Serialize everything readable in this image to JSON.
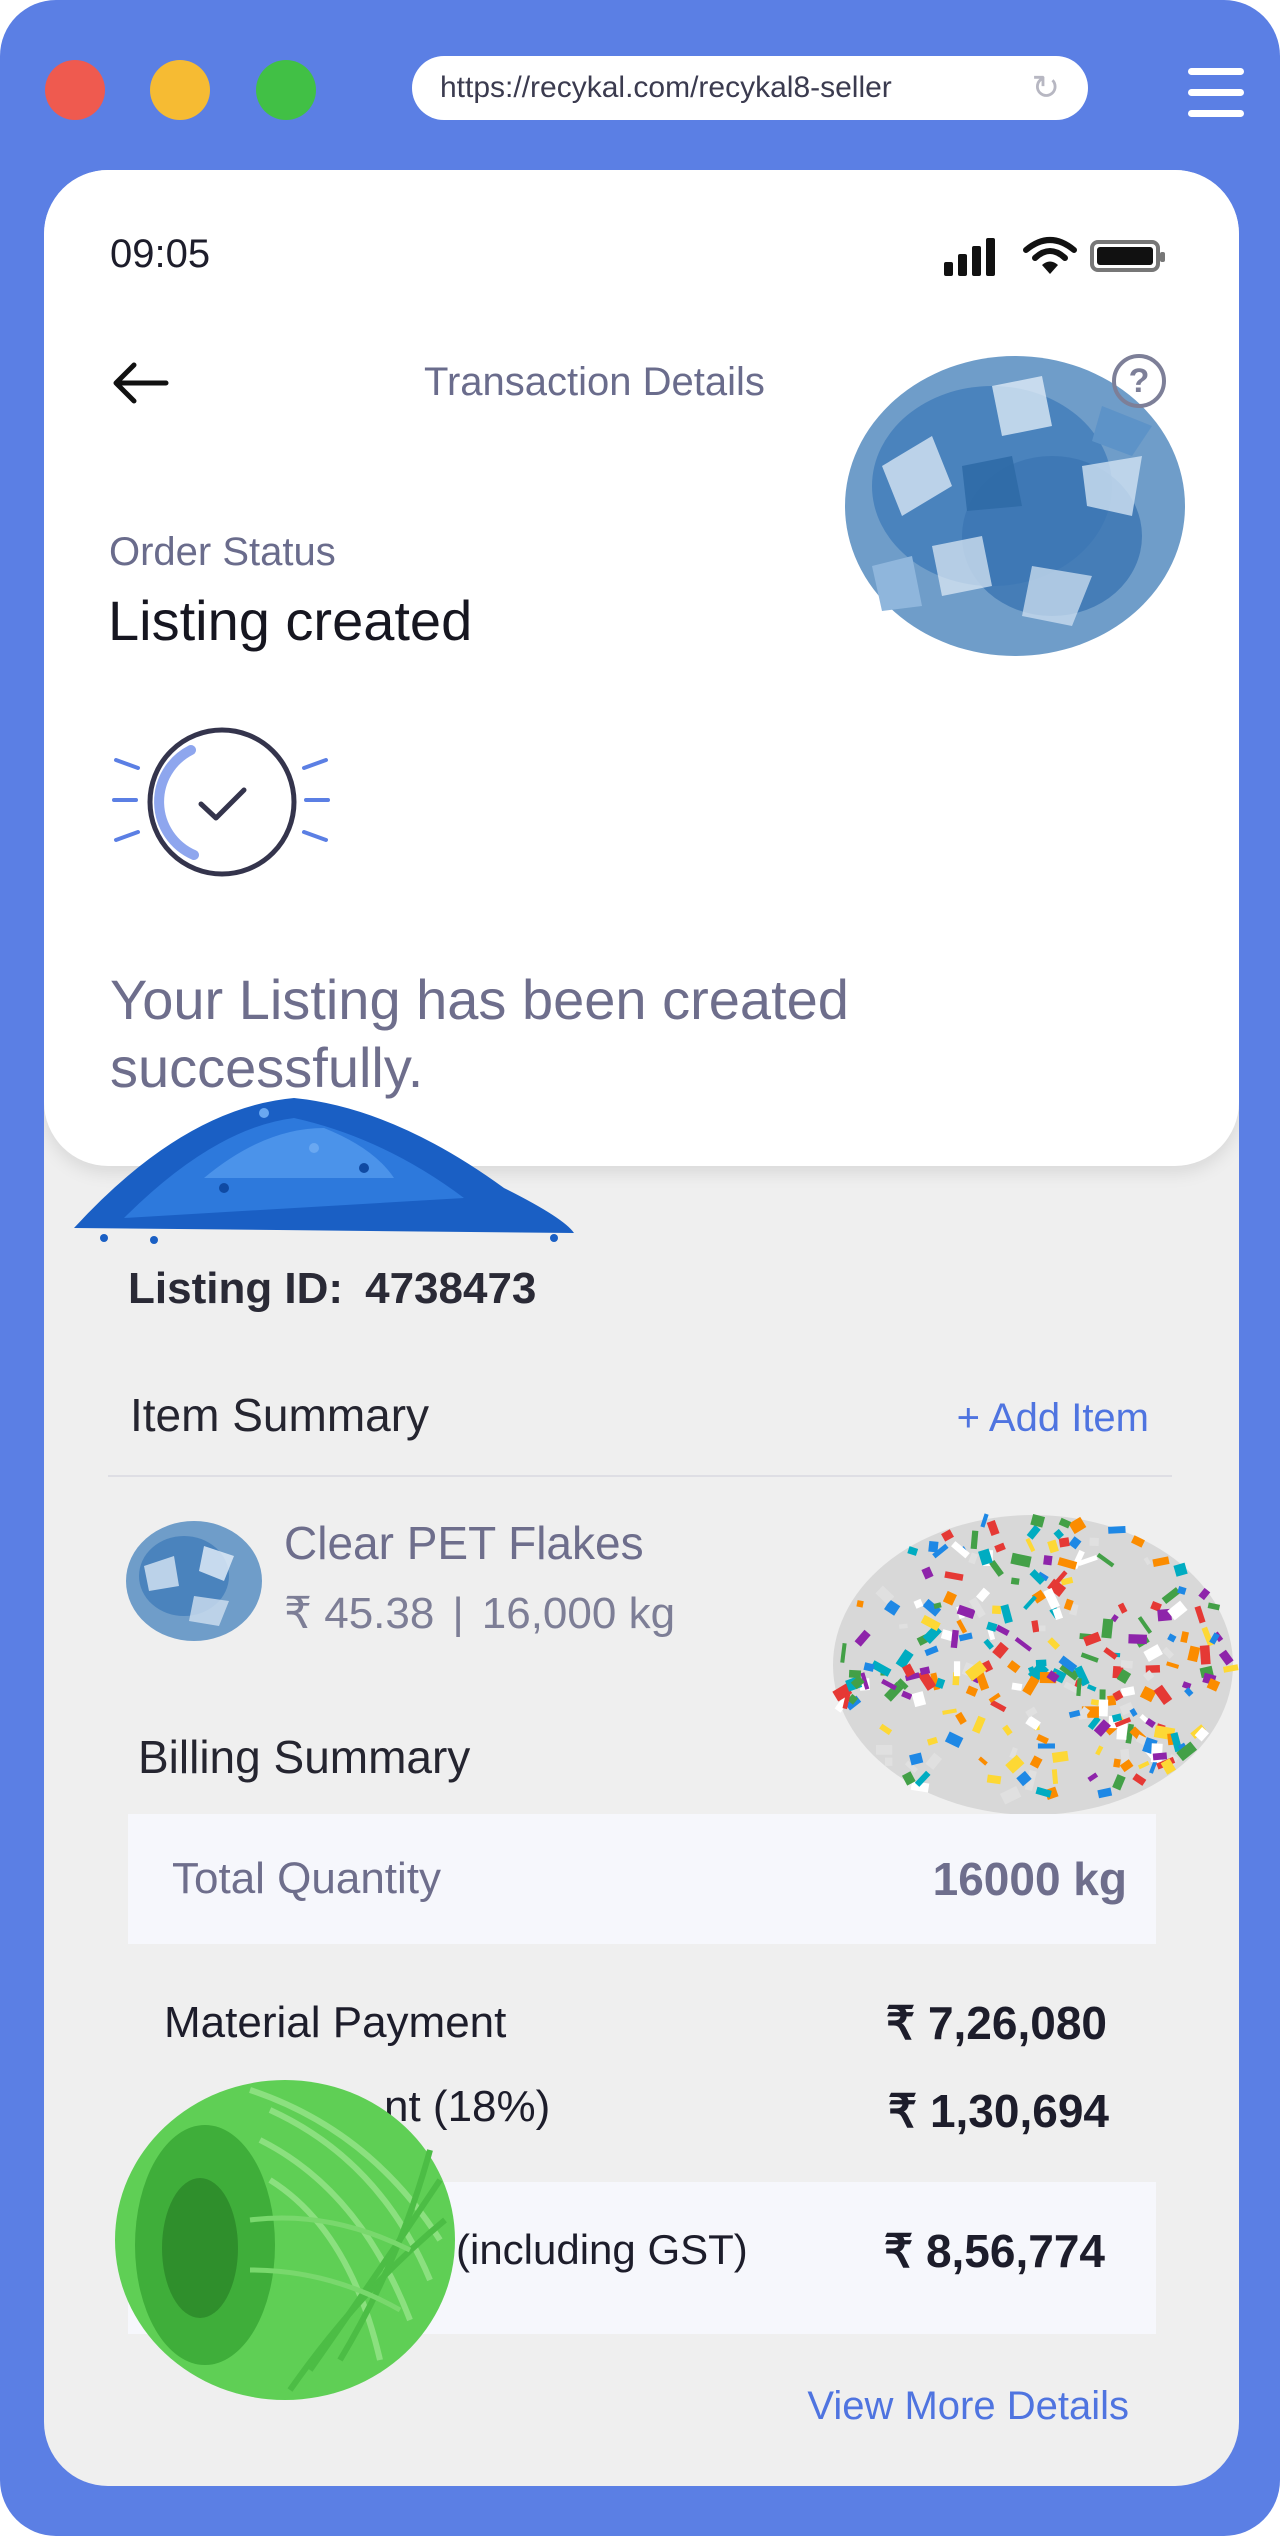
{
  "browser": {
    "url": "https://recykal.com/recykal8-seller",
    "reload_icon": "reload-icon",
    "menu_icon": "hamburger-menu-icon"
  },
  "status_bar": {
    "time": "09:05",
    "icons": [
      "signal-icon",
      "wifi-icon",
      "battery-icon"
    ]
  },
  "header": {
    "title": "Transaction Details",
    "back_icon": "back-arrow-icon",
    "help_icon": "help-icon",
    "help_glyph": "?"
  },
  "order": {
    "status_label": "Order Status",
    "status_value": "Listing created",
    "success_message": "Your Listing has been created successfully."
  },
  "listing": {
    "label": "Listing ID:",
    "id": "4738473"
  },
  "item_summary": {
    "title": "Item Summary",
    "add_label": "+ Add Item",
    "items": [
      {
        "name": "Clear PET Flakes",
        "price": "₹ 45.38",
        "separator": "|",
        "quantity": "16,000 kg"
      }
    ]
  },
  "billing": {
    "title": "Billing Summary",
    "total_quantity_label": "Total Quantity",
    "total_quantity_value": "16000 kg",
    "material_payment_label": "Material Payment",
    "material_payment_value": "₹ 7,26,080",
    "gst_label_visible": "nt (18%)",
    "gst_value": "₹ 1,30,694",
    "total_label_visible": "(including GST)",
    "total_value": "₹ 8,56,774"
  },
  "view_more_label": "View More Details",
  "colors": {
    "frame": "#5b7fe4",
    "accent": "#4f74e0",
    "muted_text": "#6e6e8c",
    "dark_text": "#1d1d2b",
    "card_bg": "#ffffff",
    "screen_bg": "#efefef"
  }
}
